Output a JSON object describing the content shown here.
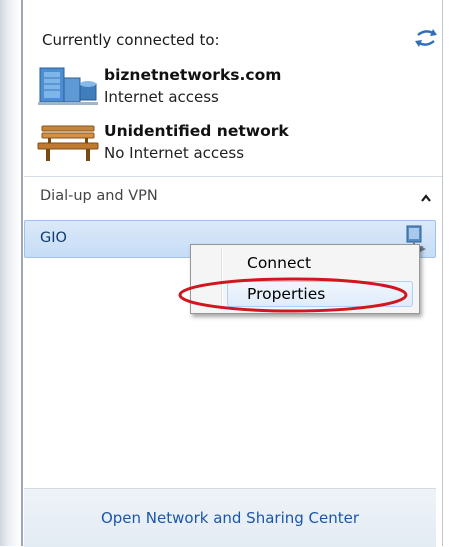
{
  "panel": {
    "header": "Currently connected to:",
    "networks": [
      {
        "name": "biznetnetworks.com",
        "status": "Internet access",
        "icon": "network-building-icon"
      },
      {
        "name": "Unidentified network",
        "status": "No Internet access",
        "icon": "park-bench-icon"
      }
    ],
    "section_title": "Dial-up and VPN",
    "vpn": {
      "label": "GIO"
    },
    "footer_link": "Open Network and Sharing Center"
  },
  "context_menu": {
    "items": [
      "Connect",
      "Properties"
    ]
  },
  "colors": {
    "highlight_ellipse": "#d0161e",
    "link": "#1d56a8"
  }
}
